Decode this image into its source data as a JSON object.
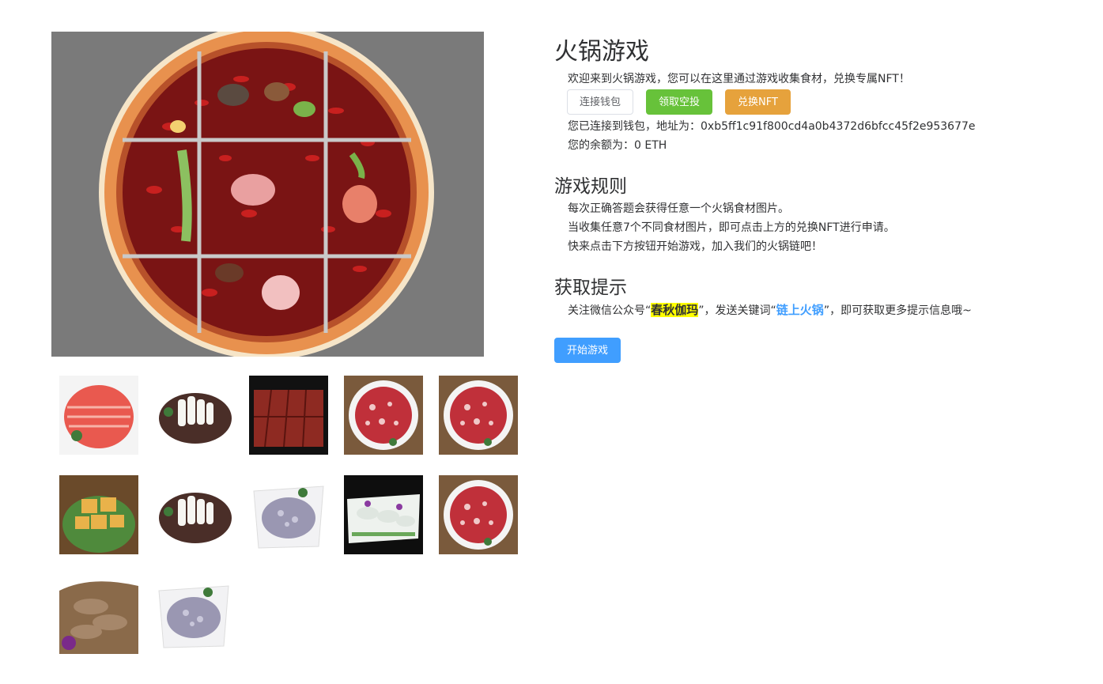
{
  "hero": {
    "image": "hotpot-nine-grid-image",
    "alt": "火锅"
  },
  "thumbnails": [
    {
      "name": "thumb-lamb-rolls",
      "kind": "lamb-rolls"
    },
    {
      "name": "thumb-rice-cake",
      "kind": "rice-cake"
    },
    {
      "name": "thumb-duck-blood",
      "kind": "duck-blood"
    },
    {
      "name": "thumb-beef-slices",
      "kind": "beef-slices"
    },
    {
      "name": "thumb-beef-slices",
      "kind": "beef-slices"
    },
    {
      "name": "thumb-fried-tofu",
      "kind": "fried-tofu"
    },
    {
      "name": "thumb-rice-cake",
      "kind": "rice-cake"
    },
    {
      "name": "thumb-shrimp-paste",
      "kind": "shrimp-paste"
    },
    {
      "name": "thumb-fish-slices",
      "kind": "fish-slices"
    },
    {
      "name": "thumb-beef-slices",
      "kind": "beef-slices"
    },
    {
      "name": "thumb-tripe",
      "kind": "tripe"
    },
    {
      "name": "thumb-shrimp-paste",
      "kind": "shrimp-paste"
    }
  ],
  "header": {
    "title": "火锅游戏",
    "welcome": "欢迎来到火锅游戏，您可以在这里通过游戏收集食材，兑换专属NFT！"
  },
  "buttons": {
    "connect_wallet": "连接钱包",
    "claim_airdrop": "领取空投",
    "redeem_nft": "兑换NFT",
    "start_game": "开始游戏"
  },
  "wallet": {
    "address_line": "您已连接到钱包，地址为：0xb5ff1c91f800cd4a0b4372d6bfcc45f2e953677e",
    "balance_line": "您的余额为：0 ETH"
  },
  "rules": {
    "title": "游戏规则",
    "lines": [
      "每次正确答题会获得任意一个火锅食材图片。",
      "当收集任意7个不同食材图片，即可点击上方的兑换NFT进行申请。",
      "快来点击下方按钮开始游戏，加入我们的火锅链吧！"
    ]
  },
  "hints": {
    "title": "获取提示",
    "prefix": "关注微信公众号“",
    "account": "春秋伽玛",
    "middle": "”，发送关键词“",
    "keyword": "链上火锅",
    "suffix": "”，即可获取更多提示信息哦~"
  },
  "colors": {
    "success": "#67c23a",
    "warning": "#e6a23c",
    "primary": "#409eff",
    "highlight": "#ffff00"
  }
}
